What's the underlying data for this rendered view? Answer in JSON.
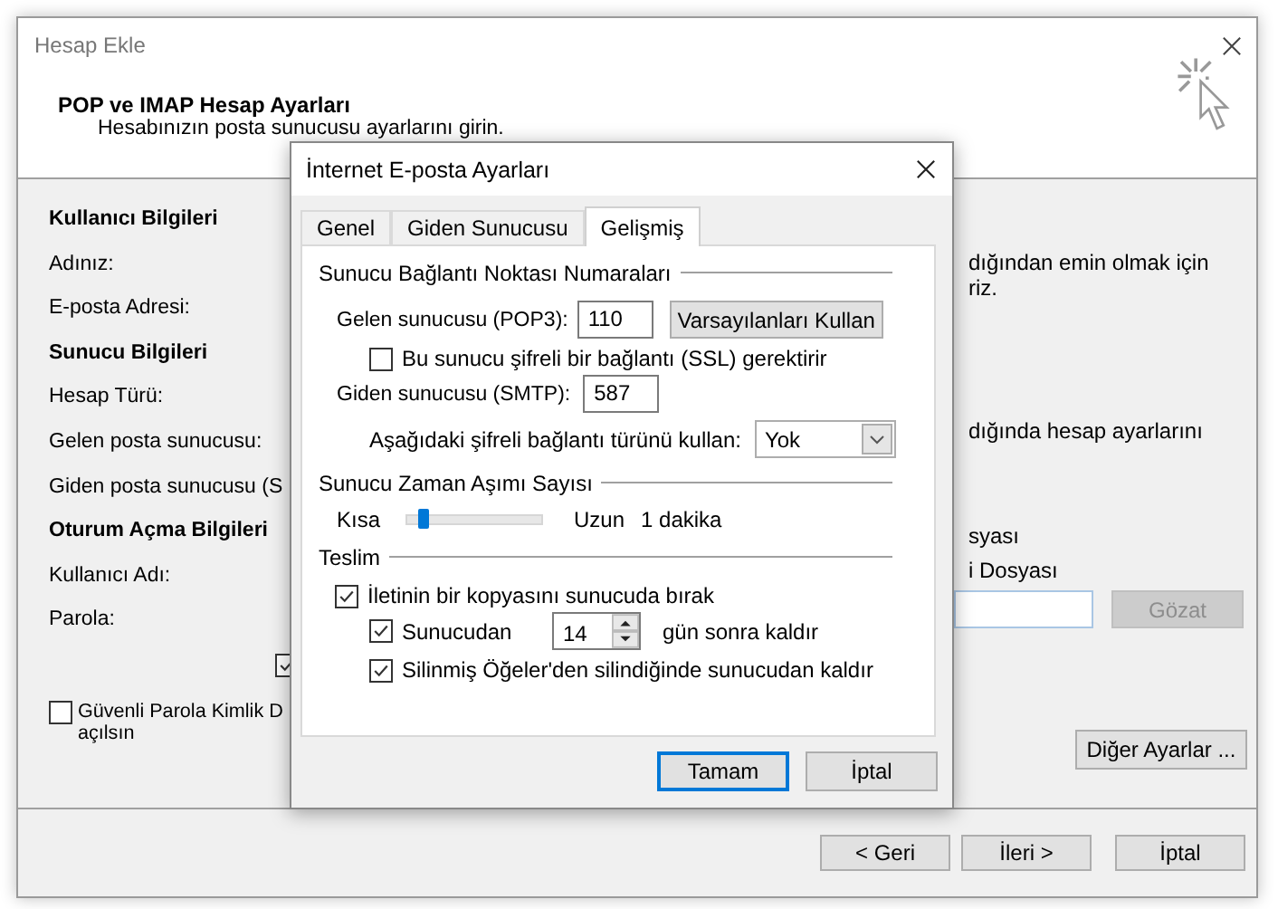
{
  "window": {
    "title": "Hesap Ekle",
    "header_title": "POP ve IMAP Hesap Ayarları",
    "header_subtitle": "Hesabınızın posta sunucusu ayarlarını girin."
  },
  "left_form": [
    {
      "kind": "heading",
      "text": "Kullanıcı Bilgileri"
    },
    {
      "kind": "label",
      "text": "Adınız:"
    },
    {
      "kind": "label",
      "text": "E-posta Adresi:"
    },
    {
      "kind": "heading",
      "text": "Sunucu Bilgileri"
    },
    {
      "kind": "label",
      "text": "Hesap Türü:"
    },
    {
      "kind": "label",
      "text": "Gelen posta sunucusu:"
    },
    {
      "kind": "label",
      "text": "Giden posta sunucusu (S"
    },
    {
      "kind": "heading",
      "text": "Oturum Açma Bilgileri"
    },
    {
      "kind": "label",
      "text": "Kullanıcı Adı:"
    },
    {
      "kind": "label",
      "text": "Parola:"
    }
  ],
  "remember_checkbox": {
    "checked": true
  },
  "spa_checkbox": {
    "checked": false,
    "label_line_1": "Güvenli Parola Kimlik D",
    "label_line_2": "açılsın"
  },
  "right_texts": [
    "dığından emin olmak için",
    "riz.",
    "dığında hesap ayarlarını",
    "syası",
    "i Dosyası"
  ],
  "browse_button": {
    "label": "Gözat",
    "disabled": true
  },
  "more_settings_button": "Diğer Ayarlar ...",
  "footer_buttons": [
    "< Geri",
    "İleri >",
    "İptal"
  ],
  "dialog": {
    "title": "İnternet E-posta Ayarları",
    "tabs": [
      {
        "label": "Genel",
        "selected": false
      },
      {
        "label": "Giden Sunucusu",
        "selected": false
      },
      {
        "label": "Gelişmiş",
        "selected": true
      }
    ],
    "ports_section": "Sunucu Bağlantı Noktası Numaraları",
    "incoming_label": "Gelen sunucusu (POP3):",
    "incoming_value": "110",
    "defaults_button": "Varsayılanları Kullan",
    "ssl_checkbox": {
      "label": "Bu sunucu şifreli bir bağlantı (SSL) gerektirir",
      "checked": false
    },
    "outgoing_label": "Giden sunucusu (SMTP):",
    "outgoing_value": "587",
    "encryption_label": "Aşağıdaki şifreli bağlantı türünü kullan:",
    "encryption_value": "Yok",
    "timeout_section": "Sunucu Zaman Aşımı Sayısı",
    "timeout": {
      "min_label": "Kısa",
      "max_label": "Uzun",
      "level": 0.12,
      "reading": "1 dakika"
    },
    "delivery_section": "Teslim",
    "leave_copy": {
      "label": "İletinin bir kopyasını sunucuda bırak",
      "checked": true
    },
    "remove_after": {
      "label": "Sunucudan",
      "checked": true,
      "days": "14",
      "suffix": "gün sonra kaldır"
    },
    "remove_deleted": {
      "label": "Silinmiş Öğeler'den silindiğinde sunucudan kaldır",
      "checked": true
    },
    "ok_button": "Tamam",
    "cancel_button": "İptal"
  }
}
